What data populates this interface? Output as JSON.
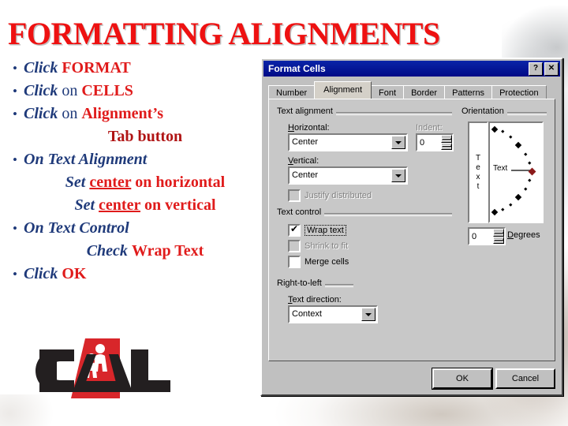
{
  "slide": {
    "title": "FORMATTING ALIGNMENTS",
    "title_color": "#ee1111",
    "accent_blue": "#1f3a7a",
    "accent_red": "#e01b1b",
    "bullets": [
      {
        "bullet": "•",
        "parts": [
          {
            "text": "Click ",
            "style": "em-blue"
          },
          {
            "text": "FORMAT",
            "style": "em-red"
          }
        ]
      },
      {
        "bullet": "•",
        "parts": [
          {
            "text": "Click ",
            "style": "em-blue"
          },
          {
            "text": "on ",
            "style": "plain-blue"
          },
          {
            "text": "CELLS",
            "style": "em-red"
          }
        ]
      },
      {
        "bullet": "•",
        "parts": [
          {
            "text": "Click ",
            "style": "em-blue"
          },
          {
            "text": "on ",
            "style": "plain-blue"
          },
          {
            "text": "Alignment’s",
            "style": "em-red"
          }
        ]
      },
      {
        "bullet": "",
        "indent": true,
        "parts": [
          {
            "text": "Tab button",
            "style": "em-darkred"
          }
        ]
      },
      {
        "bullet": "•",
        "parts": [
          {
            "text": "On Text Alignment",
            "style": "em-blue"
          }
        ]
      },
      {
        "bullet": "",
        "indent": true,
        "parts": [
          {
            "text": "Set ",
            "style": "em-blue"
          },
          {
            "text": "center",
            "style": "em-red-ul"
          },
          {
            "text": " on horizontal",
            "style": "em-red"
          }
        ]
      },
      {
        "bullet": "",
        "indent": true,
        "parts": [
          {
            "text": "Set ",
            "style": "em-blue"
          },
          {
            "text": "center",
            "style": "em-red-ul"
          },
          {
            "text": " on vertical",
            "style": "em-red"
          }
        ]
      },
      {
        "bullet": "•",
        "parts": [
          {
            "text": "On Text Control",
            "style": "em-blue"
          }
        ]
      },
      {
        "bullet": "",
        "indent": true,
        "parts": [
          {
            "text": "Check ",
            "style": "em-blue"
          },
          {
            "text": "Wrap Text",
            "style": "em-red"
          }
        ]
      },
      {
        "bullet": "•",
        "parts": [
          {
            "text": "Click ",
            "style": "em-blue"
          },
          {
            "text": "OK",
            "style": "em-red"
          }
        ]
      }
    ],
    "logo": {
      "name": "CAL",
      "letter_color": "#231f20",
      "triangle_color": "#d8262a"
    }
  },
  "dialog": {
    "title": "Format Cells",
    "titlebar_color": "#000a86",
    "help_button": "?",
    "close_button": "✕",
    "tabs": [
      {
        "label": "Number",
        "active": false
      },
      {
        "label": "Alignment",
        "active": true
      },
      {
        "label": "Font",
        "active": false
      },
      {
        "label": "Border",
        "active": false
      },
      {
        "label": "Patterns",
        "active": false
      },
      {
        "label": "Protection",
        "active": false
      }
    ],
    "text_alignment": {
      "group_label": "Text alignment",
      "horizontal_label": "Horizontal:",
      "horizontal_value": "Center",
      "vertical_label": "Vertical:",
      "vertical_value": "Center",
      "indent_label": "Indent:",
      "indent_value": "0",
      "justify_distributed_label": "Justify distributed",
      "justify_distributed_checked": false,
      "justify_distributed_disabled": true
    },
    "text_control": {
      "group_label": "Text control",
      "items": [
        {
          "label": "Wrap text",
          "checked": true,
          "disabled": false,
          "focused": true
        },
        {
          "label": "Shrink to fit",
          "checked": false,
          "disabled": true,
          "focused": false
        },
        {
          "label": "Merge cells",
          "checked": false,
          "disabled": false,
          "focused": false
        }
      ]
    },
    "right_to_left": {
      "group_label": "Right-to-left",
      "direction_label": "Text direction:",
      "direction_value": "Context"
    },
    "orientation": {
      "group_label": "Orientation",
      "vertical_text": "Text",
      "dial_text": "Text",
      "degrees_value": "0",
      "degrees_label": "Degrees",
      "marker_color": "#8b1a1a"
    },
    "buttons": {
      "ok": "OK",
      "cancel": "Cancel"
    }
  }
}
